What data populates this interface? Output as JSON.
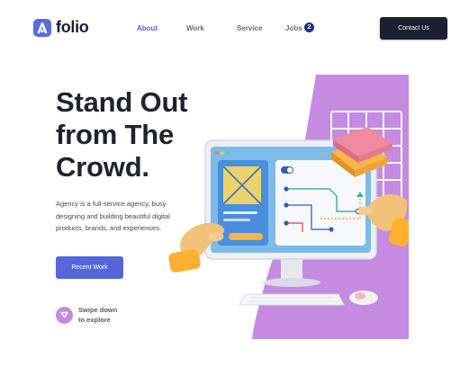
{
  "brand": {
    "name": "folio",
    "logo_icon": "folio-logo-icon",
    "accent": "#5b6ce0"
  },
  "nav": {
    "items": [
      {
        "label": "About",
        "active": true
      },
      {
        "label": "Work",
        "active": false
      },
      {
        "label": "Service",
        "active": false
      },
      {
        "label": "Jobs",
        "active": false
      }
    ],
    "jobs_badge": "2"
  },
  "header": {
    "contact_label": "Contact Us",
    "contact_color": "#1e1e31"
  },
  "hero": {
    "title_lines": [
      "Stand Out",
      "from The",
      "Crowd."
    ],
    "description": "Agency is a full-service agency, busy designing and building beautiful digital products, brands, and experiences.",
    "cta_label": "Recent Work",
    "cta_color": "#5566dc",
    "scroll_lines": [
      "Swipe down",
      "to explore"
    ],
    "scroll_icon": "arrow-down-icon"
  },
  "illustration": {
    "name": "computer-hands-illustration",
    "background_color": "#c48be0"
  }
}
